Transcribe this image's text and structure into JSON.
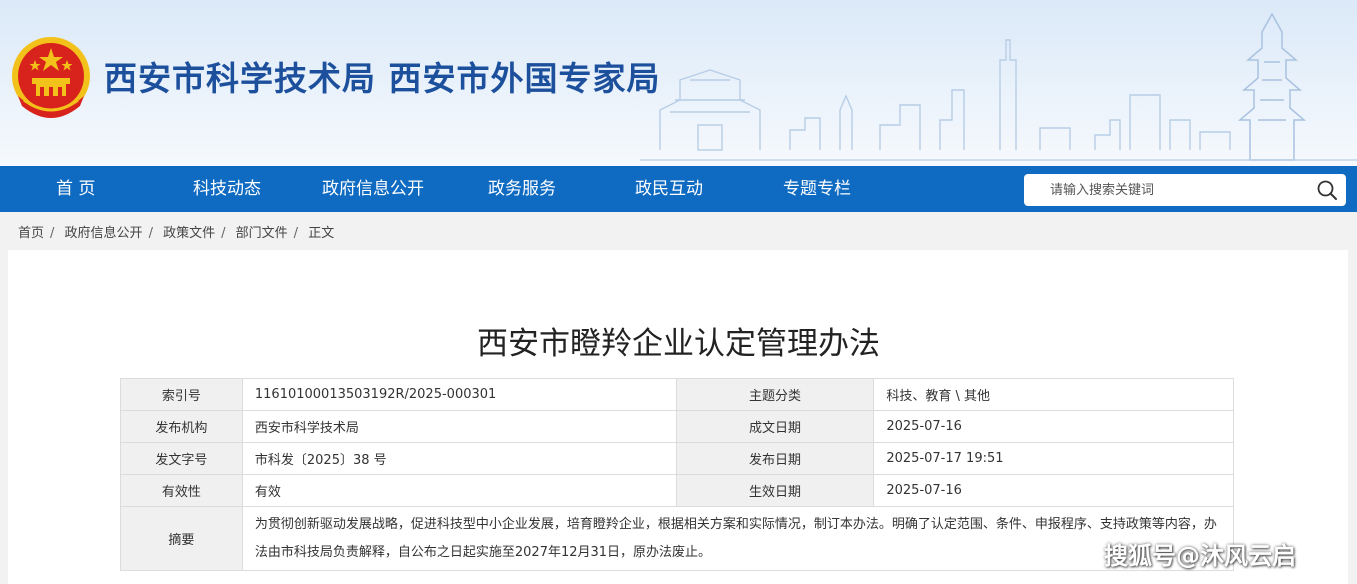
{
  "header": {
    "site_title": "西安市科学技术局  西安市外国专家局"
  },
  "nav": {
    "items": [
      {
        "label": "首  页"
      },
      {
        "label": "科技动态"
      },
      {
        "label": "政府信息公开"
      },
      {
        "label": "政务服务"
      },
      {
        "label": "政民互动"
      },
      {
        "label": "专题专栏"
      }
    ],
    "search_placeholder": "请输入搜索关键词"
  },
  "breadcrumb": [
    "首页",
    "政府信息公开",
    "政策文件",
    "部门文件",
    "正文"
  ],
  "document": {
    "title": "西安市瞪羚企业认定管理办法",
    "meta": {
      "index_no_label": "索引号",
      "index_no": "11610100013503192R/2025-000301",
      "topic_label": "主题分类",
      "topic": "科技、教育 \\ 其他",
      "publisher_label": "发布机构",
      "publisher": "西安市科学技术局",
      "created_label": "成文日期",
      "created": "2025-07-16",
      "doc_no_label": "发文字号",
      "doc_no": "市科发〔2025〕38 号",
      "published_label": "发布日期",
      "published": "2025-07-17 19:51",
      "validity_label": "有效性",
      "validity": "有效",
      "effective_label": "生效日期",
      "effective": "2025-07-16",
      "summary_label": "摘要",
      "summary": "为贯彻创新驱动发展战略，促进科技型中小企业发展，培育瞪羚企业，根据相关方案和实际情况，制订本办法。明确了认定范围、条件、申报程序、支持政策等内容，办法由市科技局负责解释，自公布之日起实施至2027年12月31日，原办法废止。"
    }
  },
  "watermark": "搜狐号@沐风云启",
  "colors": {
    "nav_bg": "#0f6bc2",
    "title_blue": "#1c4f9c",
    "emblem_red": "#d8231c",
    "emblem_gold": "#f3c21a"
  },
  "icons": {
    "search": "search-icon",
    "emblem": "national-emblem-icon"
  }
}
